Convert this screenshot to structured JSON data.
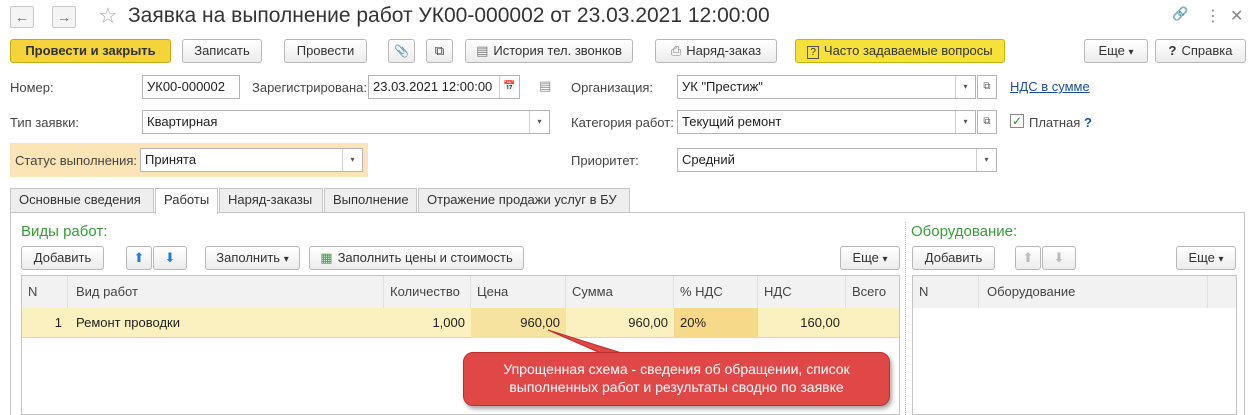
{
  "window": {
    "title": "Заявка на выполнение работ УК00-000002 от 23.03.2021 12:00:00",
    "back_glyph": "←",
    "forward_glyph": "→",
    "star_glyph": "☆",
    "link_glyph": "🔗",
    "more_glyph": "⋮",
    "close_glyph": "✕"
  },
  "toolbar": {
    "post_close": "Провести и закрыть",
    "save": "Записать",
    "post": "Провести",
    "attach_glyph": "📎",
    "structure_glyph": "⧉",
    "call_history": "История тел. звонков",
    "work_order": "Наряд-заказ",
    "faq": "Часто задаваемые вопросы",
    "more": "Еще",
    "help": "Справка",
    "help_glyph": "?",
    "dropdown_glyph": "▾"
  },
  "form": {
    "number_label": "Номер:",
    "number_value": "УК00-000002",
    "registered_label": "Зарегистрирована:",
    "registered_value": "23.03.2021 12:00:00",
    "calendar_glyph": "📅",
    "comment_glyph": "▤",
    "organization_label": "Организация:",
    "organization_value": "УК \"Престиж\"",
    "vat_link": "НДС в сумме",
    "request_type_label": "Тип заявки:",
    "request_type_value": "Квартирная",
    "work_category_label": "Категория работ:",
    "work_category_value": "Текущий ремонт",
    "paid_label": "Платная",
    "paid_checked": true,
    "paid_help": "?",
    "status_label": "Статус выполнения:",
    "status_value": "Принята",
    "priority_label": "Приоритет:",
    "priority_value": "Средний",
    "open_glyph": "⧉"
  },
  "tabs": [
    {
      "label": "Основные сведения"
    },
    {
      "label": "Работы"
    },
    {
      "label": "Наряд-заказы"
    },
    {
      "label": "Выполнение"
    },
    {
      "label": "Отражение продажи услуг в БУ"
    }
  ],
  "works": {
    "title": "Виды работ:",
    "add": "Добавить",
    "fill": "Заполнить",
    "fill_prices": "Заполнить цены и стоимость",
    "more": "Еще",
    "columns": [
      "N",
      "Вид работ",
      "Количество",
      "Цена",
      "Сумма",
      "% НДС",
      "НДС",
      "Всего"
    ],
    "rows": [
      {
        "n": "1",
        "work": "Ремонт проводки",
        "qty": "1,000",
        "price": "960,00",
        "sum": "960,00",
        "vat_rate": "20%",
        "vat": "160,00",
        "total": ""
      }
    ]
  },
  "equipment": {
    "title": "Оборудование:",
    "add": "Добавить",
    "more": "Еще",
    "columns": [
      "N",
      "Оборудование"
    ]
  },
  "callout": {
    "line1": "Упрощенная схема - сведения об обращении, список",
    "line2": "выполненных работ и результаты сводно по заявке"
  },
  "colors": {
    "accent_yellow": "#f5d33b",
    "section_green": "#3a9a3a",
    "highlight_row": "#fbf0c0",
    "callout_red": "#e04747"
  }
}
